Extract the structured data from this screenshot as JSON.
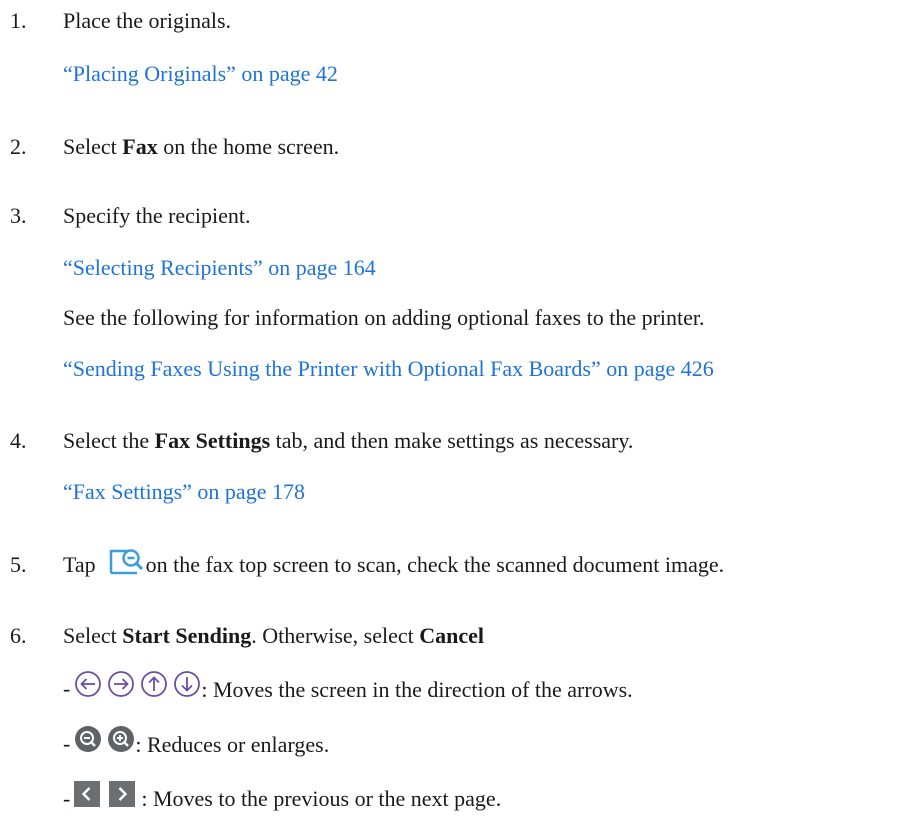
{
  "steps": [
    {
      "number": "1.",
      "text": "Place the originals.",
      "link": "“Placing Originals” on page 42"
    },
    {
      "number": "2.",
      "pre": "Select ",
      "bold": "Fax",
      "post": " on the home screen."
    },
    {
      "number": "3.",
      "text": "Specify the recipient.",
      "link": "“Selecting Recipients” on page 164",
      "note": "See the following for information on adding optional faxes to the printer.",
      "link2": "“Sending Faxes Using the Printer with Optional Fax Boards” on page 426"
    },
    {
      "number": "4.",
      "pre": "Select the ",
      "bold": "Fax Settings",
      "post": " tab, and then make settings as necessary.",
      "link": "“Fax Settings” on page 178"
    },
    {
      "number": "5.",
      "pre": "Tap",
      "post": " on the fax top screen to scan, check the scanned document image."
    },
    {
      "number": "6.",
      "pre": "Select ",
      "bold": "Start Sending",
      "mid": ". Otherwise, select ",
      "bold2": "Cancel"
    }
  ],
  "bullets": [
    {
      "dash": "-",
      "text": ": Moves the screen in the direction of the arrows.",
      "icons": [
        "arrow-left-icon",
        "arrow-right-icon",
        "arrow-up-icon",
        "arrow-down-icon"
      ]
    },
    {
      "dash": "-",
      "text": ": Reduces or enlarges.",
      "icons": [
        "zoom-out-icon",
        "zoom-in-icon"
      ]
    },
    {
      "dash": "-",
      "text": ": Moves to the previous or the next page.",
      "icons": [
        "previous-page-icon",
        "next-page-icon"
      ]
    }
  ],
  "colors": {
    "text": "#1a1a1a",
    "link": "#1e73d9",
    "icon_accent": "#3a9fd6",
    "icon_gray": "#8a8a8a",
    "icon_purple": "#6c4ea0",
    "zoom_dark": "#5f6368",
    "page_button": "#6b6f72"
  }
}
